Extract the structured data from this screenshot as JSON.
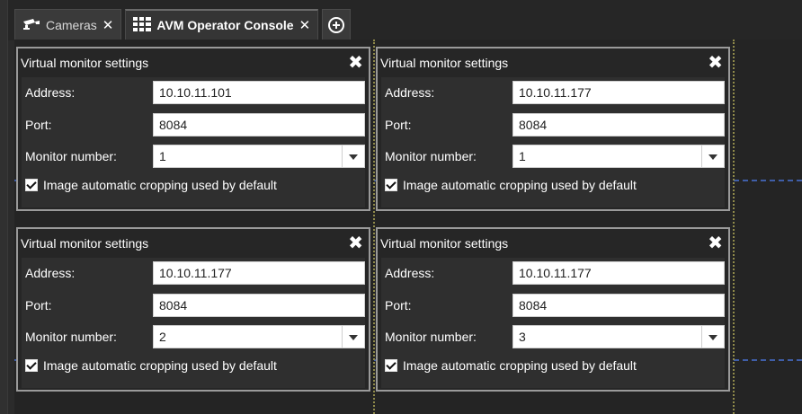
{
  "tabs": [
    {
      "label": "Cameras",
      "icon": "camera-icon",
      "active": false
    },
    {
      "label": "AVM Operator Console",
      "icon": "grid-icon",
      "active": true
    }
  ],
  "panels": [
    {
      "title": "Virtual monitor settings",
      "address_label": "Address:",
      "address": "10.10.11.101",
      "port_label": "Port:",
      "port": "8084",
      "monitor_label": "Monitor number:",
      "monitor": "1",
      "cropping_label": "Image automatic cropping used by default",
      "cropping_checked": true
    },
    {
      "title": "Virtual monitor settings",
      "address_label": "Address:",
      "address": "10.10.11.177",
      "port_label": "Port:",
      "port": "8084",
      "monitor_label": "Monitor number:",
      "monitor": "1",
      "cropping_label": "Image automatic cropping used by default",
      "cropping_checked": true
    },
    {
      "title": "Virtual monitor settings",
      "address_label": "Address:",
      "address": "10.10.11.177",
      "port_label": "Port:",
      "port": "8084",
      "monitor_label": "Monitor number:",
      "monitor": "2",
      "cropping_label": "Image automatic cropping used by default",
      "cropping_checked": true
    },
    {
      "title": "Virtual monitor settings",
      "address_label": "Address:",
      "address": "10.10.11.177",
      "port_label": "Port:",
      "port": "8084",
      "monitor_label": "Monitor number:",
      "monitor": "3",
      "cropping_label": "Image automatic cropping used by default",
      "cropping_checked": true
    }
  ],
  "colors": {
    "background": "#242424",
    "panel_border": "#9a9a9a",
    "grid_line_horizontal": "#3f5ea8",
    "grid_line_vertical": "#8f8a4a"
  }
}
